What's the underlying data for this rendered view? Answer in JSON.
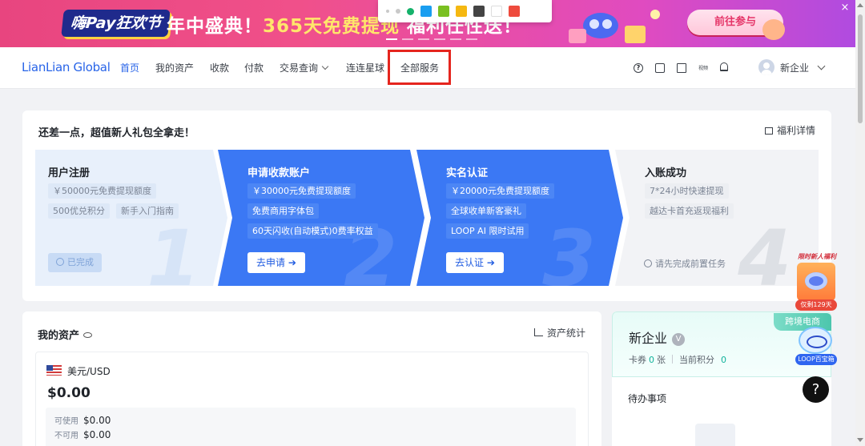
{
  "banner": {
    "logo": "嗨Pay狂欢节",
    "headline_pre": "年中盛典！",
    "headline_hl": "365天免费提现",
    "headline_post": "福利任性送！",
    "cta": "前往参与",
    "close": "×"
  },
  "toolbar": {
    "swatches": [
      "#1a9ef0",
      "#7ac021",
      "#f5b811",
      "#444444",
      "#ffffff",
      "#ee4b3d"
    ]
  },
  "nav": {
    "brand": "LianLian Global",
    "items": [
      "首页",
      "我的资产",
      "收款",
      "付款",
      "交易查询",
      "连连星球",
      "全部服务"
    ],
    "small_label": "视频",
    "user": "新企业"
  },
  "welcome": {
    "title": "还差一点，超值新人礼包全拿走！",
    "benefit_link": "福利详情",
    "steps": [
      {
        "title": "用户注册",
        "tags": [
          "￥50000元免费提现额度",
          "500优兑积分",
          "新手入门指南"
        ],
        "status": "已完成",
        "num": "1"
      },
      {
        "title": "申请收款账户",
        "tags": [
          "￥30000元免费提现额度",
          "免费商用字体包",
          "60天闪收(自动模式)0费率权益"
        ],
        "button": "去申请 ➔",
        "num": "2"
      },
      {
        "title": "实名认证",
        "tags": [
          "￥20000元免费提现额度",
          "全球收单新客豪礼",
          "LOOP AI 限时试用"
        ],
        "button": "去认证 ➔",
        "num": "3"
      },
      {
        "title": "入账成功",
        "tags": [
          "7*24小时快速提现",
          "越达卡首充返现福利"
        ],
        "pending": "请先完成前置任务",
        "num": "4"
      }
    ]
  },
  "assets": {
    "title": "我的资产",
    "stats_link": "资产统计",
    "currency": "美元/USD",
    "balance": "$0.00",
    "available_label": "可使用",
    "available": "$0.00",
    "unavailable_label": "不可用",
    "unavailable": "$0.00"
  },
  "profile": {
    "name": "新企业",
    "level": "V",
    "coupons_label": "卡券",
    "coupons": "0",
    "coupons_unit": "张",
    "points_label": "当前积分",
    "points": "0",
    "corner_tag": "跨境电商",
    "todo": "待办事项"
  },
  "floats": {
    "promo_top": "限时新人福利",
    "promo_badge": "仅剩129天",
    "loop_badge": "LOOP百宝箱",
    "help": "?"
  }
}
